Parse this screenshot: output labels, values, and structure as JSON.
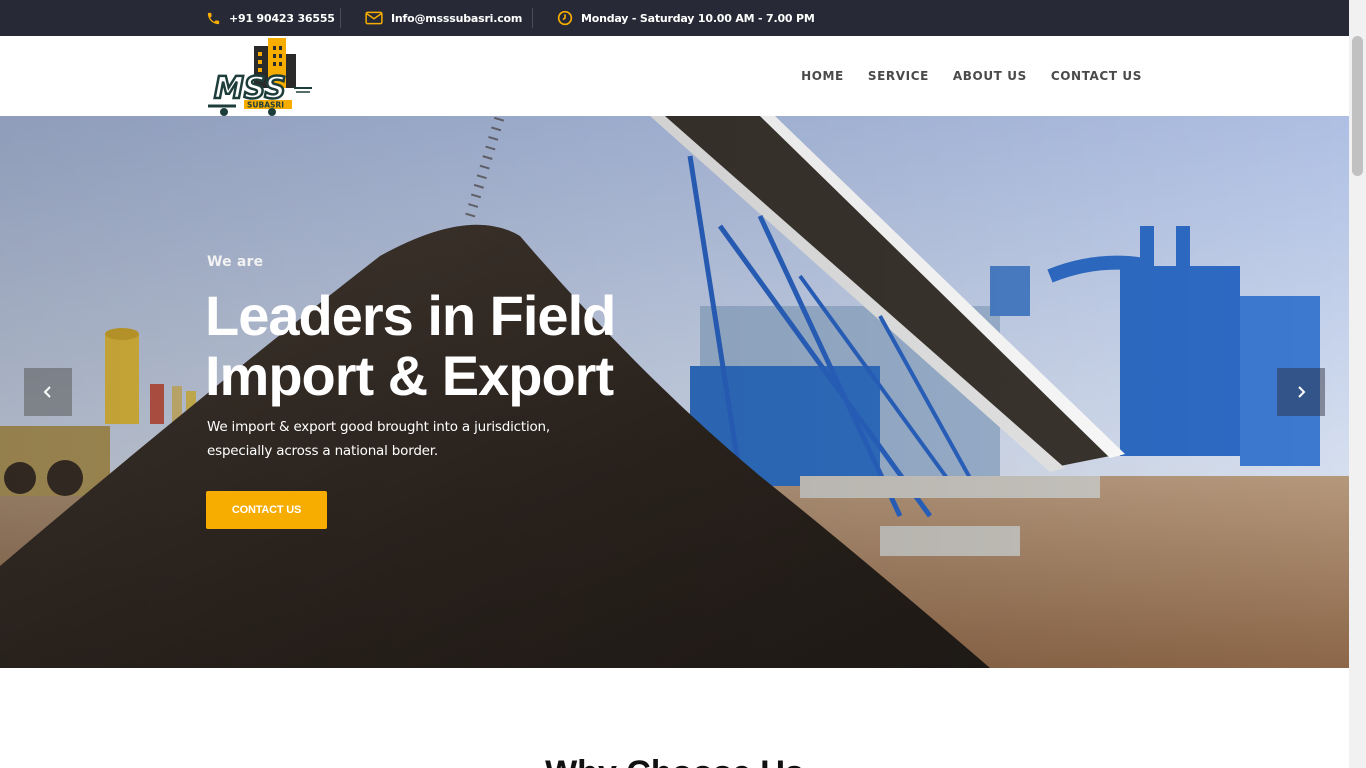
{
  "topbar": {
    "phone": "+91 90423 36555",
    "email": "Info@msssubasri.com",
    "hours": "Monday - Saturday 10.00 AM - 7.00 PM",
    "icon_color": "#f7ad00"
  },
  "logo": {
    "text": "MSS",
    "subtext": "SUBASRI"
  },
  "nav": {
    "items": [
      "HOME",
      "SERVICE",
      "ABOUT US",
      "CONTACT US"
    ]
  },
  "hero": {
    "kicker": "We are",
    "headline_line1": "Leaders in Field",
    "headline_line2": "Import & Export",
    "subtitle_line1": "We import & export good brought into a jurisdiction,",
    "subtitle_line2": "especially across a national border.",
    "cta_label": "CONTACT US",
    "accent_color": "#f7ad00"
  },
  "section": {
    "title": "Why Choose Us"
  }
}
